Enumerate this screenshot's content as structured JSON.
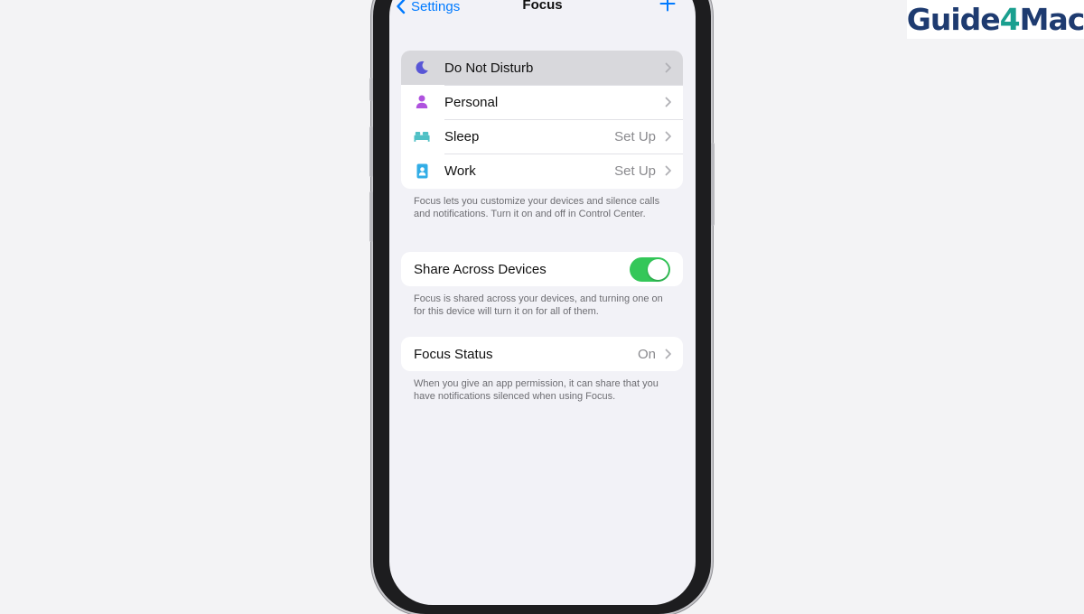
{
  "nav": {
    "back_label": "Settings",
    "title": "Focus"
  },
  "focus_modes": [
    {
      "label": "Do Not Disturb",
      "icon": "moon-icon",
      "detail": "",
      "color": "#5856d6"
    },
    {
      "label": "Personal",
      "icon": "person-icon",
      "detail": "",
      "color": "#af52de"
    },
    {
      "label": "Sleep",
      "icon": "bed-icon",
      "detail": "Set Up",
      "color": "#4fc0c5"
    },
    {
      "label": "Work",
      "icon": "badge-icon",
      "detail": "Set Up",
      "color": "#32ade6"
    }
  ],
  "focus_footnote": "Focus lets you customize your devices and silence calls and notifications. Turn it on and off in Control Center.",
  "share": {
    "label": "Share Across Devices",
    "enabled": true,
    "footnote": "Focus is shared across your devices, and turning one on for this device will turn it on for all of them."
  },
  "focus_status": {
    "label": "Focus Status",
    "value": "On",
    "footnote": "When you give an app permission, it can share that you have notifications silenced when using Focus."
  },
  "logo": {
    "text_part1": "Guide",
    "text_part2": "4",
    "text_part3": "Mac"
  },
  "colors": {
    "accent": "#007aff",
    "toggle_on": "#34c759",
    "background": "#f2f2f7"
  }
}
